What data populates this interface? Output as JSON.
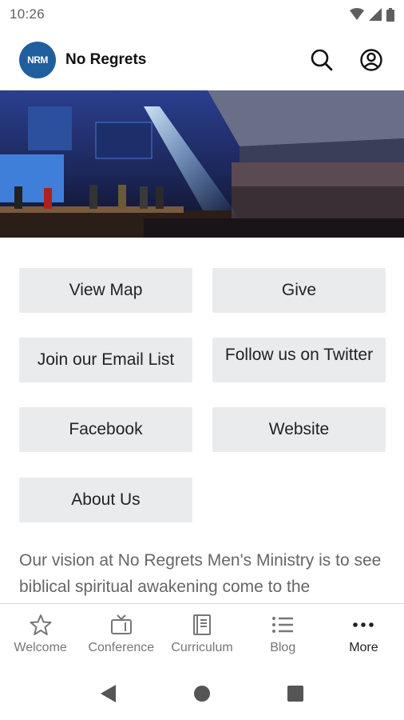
{
  "status_bar": {
    "time": "10:26"
  },
  "app_bar": {
    "logo_text": "NRM",
    "title": "No Regrets"
  },
  "buttons": [
    {
      "label": "View Map"
    },
    {
      "label": "Give"
    },
    {
      "label": "Join our Email List"
    },
    {
      "label": "Follow us on Twitter"
    },
    {
      "label": "Facebook"
    },
    {
      "label": "Website"
    },
    {
      "label": "About Us"
    }
  ],
  "vision_text": "Our vision at No Regrets Men's Ministry is to see biblical spiritual awakening come to the",
  "bottom_nav": [
    {
      "label": "Welcome",
      "icon": "star-icon"
    },
    {
      "label": "Conference",
      "icon": "tv-icon"
    },
    {
      "label": "Curriculum",
      "icon": "book-icon"
    },
    {
      "label": "Blog",
      "icon": "list-icon"
    },
    {
      "label": "More",
      "icon": "more-dots-icon"
    }
  ],
  "colors": {
    "accent": "#1f5f9e",
    "tile": "#e9ebed"
  }
}
